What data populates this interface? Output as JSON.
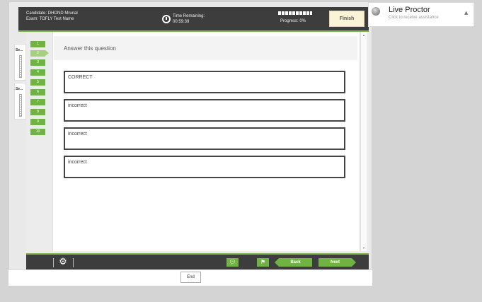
{
  "header": {
    "candidate_line": "Candidate: DHOND Mrunal",
    "exam_line": "Exam: TOFLY Test Name",
    "time_label": "Time Remaining:",
    "time_value": "00:59:39",
    "progress_label": "Progress: 0%",
    "finish_label": "Finish",
    "timer_icon": "clock-icon"
  },
  "sections": [
    {
      "label": "Se..."
    },
    {
      "label": "Se..."
    }
  ],
  "question_numbers": [
    "1",
    "2",
    "3",
    "4",
    "5",
    "6",
    "7",
    "8",
    "9",
    "10"
  ],
  "current_question": "2",
  "question": {
    "prompt": "Answer this question",
    "answers": [
      "CORRECT",
      "incorrect",
      "incorrect",
      "incorrect"
    ]
  },
  "footer": {
    "settings_icon": "gear-icon",
    "comment_icon": "comment-icon",
    "flag_icon": "flag-icon",
    "back_label": "Back",
    "next_label": "Next",
    "end_label": "End"
  },
  "proctor": {
    "title": "Live Proctor",
    "subtitle": "Click to receive assistance",
    "collapse_icon": "caret-up-icon"
  },
  "colors": {
    "accent_green": "#71b343",
    "header_dark": "#3d3d3d",
    "finish_bg": "#fbf3d5"
  }
}
